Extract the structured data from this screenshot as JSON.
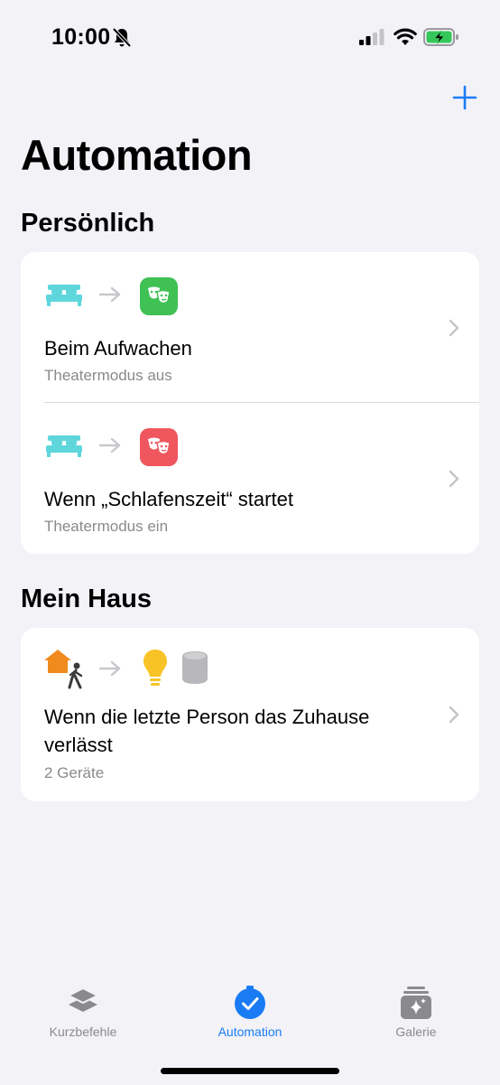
{
  "status_bar": {
    "time": "10:00"
  },
  "header": {
    "title": "Automation"
  },
  "sections": [
    {
      "title": "Persönlich",
      "items": [
        {
          "title": "Beim Aufwachen",
          "subtitle": "Theatermodus aus"
        },
        {
          "title": "Wenn „Schlafenszeit“ startet",
          "subtitle": "Theatermodus ein"
        }
      ]
    },
    {
      "title": "Mein Haus",
      "items": [
        {
          "title_line1": "Wenn die letzte Person das Zuhause",
          "title_line2": "verlässt",
          "subtitle": "2 Geräte"
        }
      ]
    }
  ],
  "tabbar": {
    "tabs": [
      {
        "label": "Kurzbefehle"
      },
      {
        "label": "Automation"
      },
      {
        "label": "Galerie"
      }
    ]
  },
  "colors": {
    "accent": "#1a7cf5",
    "bed": "#5ed6dc",
    "tile_off": "#3fc154",
    "tile_on": "#f0565e",
    "house": "#f08a1c",
    "bulb": "#f7c326"
  }
}
